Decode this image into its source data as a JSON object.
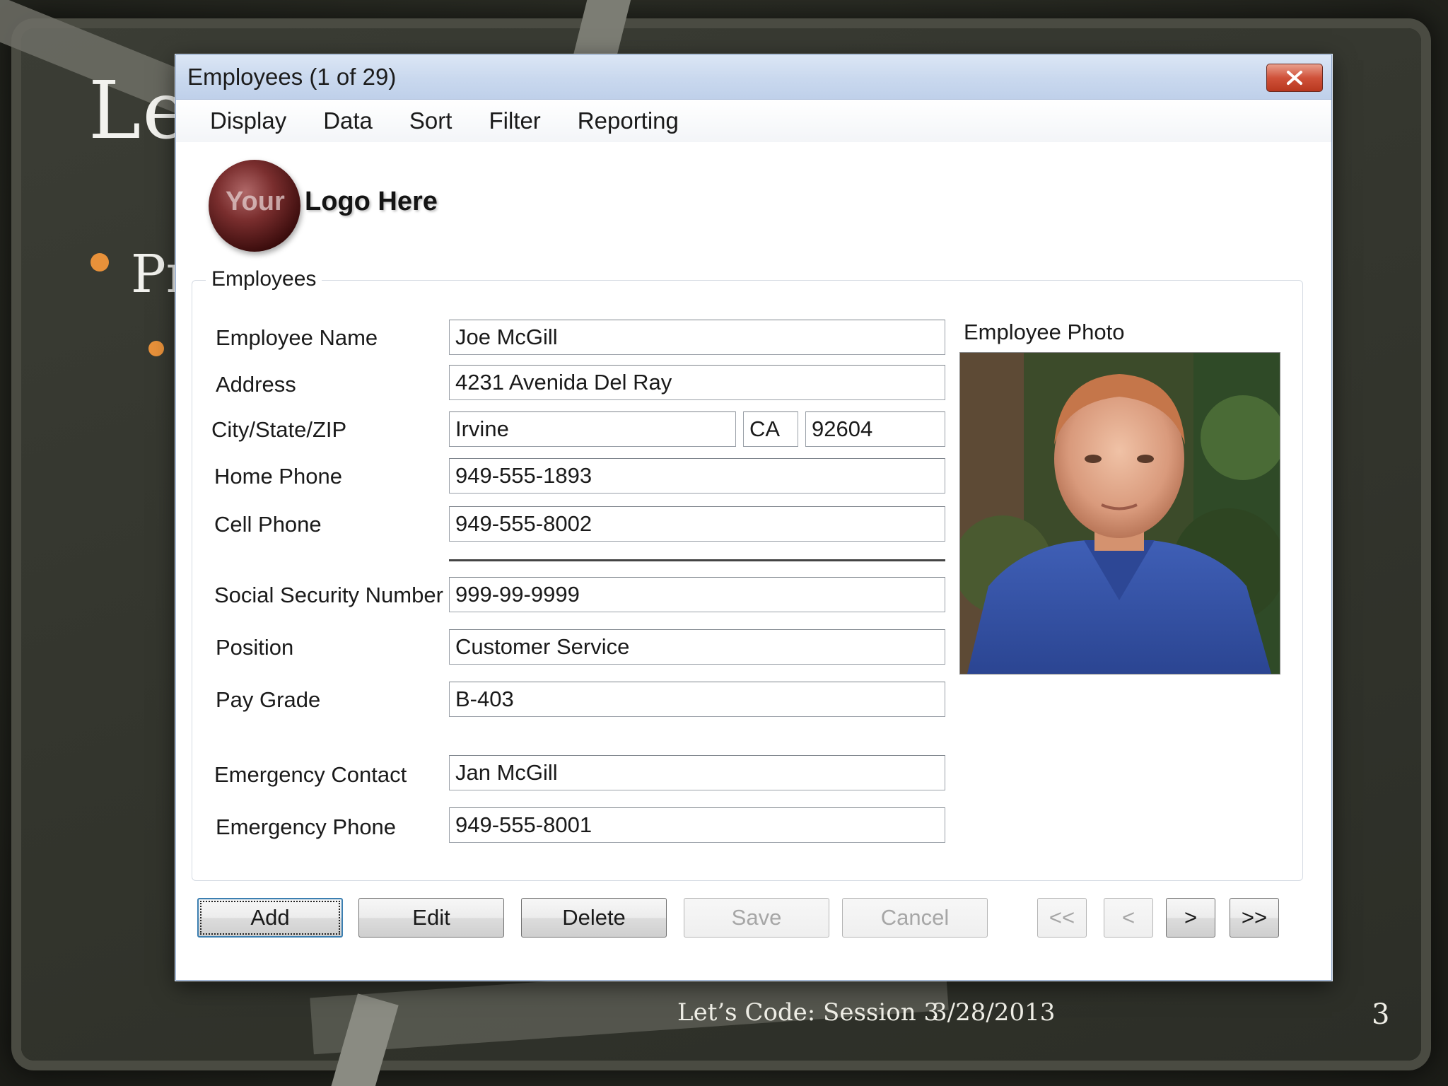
{
  "slide": {
    "title": "Le",
    "bullet_text": "Pr",
    "footer_title": "Let’s Code: Session 3",
    "footer_date": "3/28/2013",
    "page_number": "3"
  },
  "window": {
    "title": "Employees  (1 of 29)",
    "close_icon": "close-x-icon"
  },
  "menu": [
    "Display",
    "Data",
    "Sort",
    "Filter",
    "Reporting"
  ],
  "logo": {
    "your": "Your",
    "here": "Logo Here"
  },
  "group": {
    "label": "Employees"
  },
  "fields": {
    "employee_name": {
      "label": "Employee Name",
      "value": "Joe McGill"
    },
    "address": {
      "label": "Address",
      "value": "4231 Avenida Del Ray"
    },
    "city_state_zip": {
      "label": "City/State/ZIP",
      "city": "Irvine",
      "state": "CA",
      "zip": "92604"
    },
    "home_phone": {
      "label": "Home Phone",
      "value": "949-555-1893"
    },
    "cell_phone": {
      "label": "Cell Phone",
      "value": "949-555-8002"
    },
    "ssn": {
      "label": "Social Security Number",
      "value": "999-99-9999"
    },
    "position": {
      "label": "Position",
      "value": "Customer Service"
    },
    "pay_grade": {
      "label": "Pay Grade",
      "value": "B-403"
    },
    "emergency_contact": {
      "label": "Emergency Contact",
      "value": "Jan McGill"
    },
    "emergency_phone": {
      "label": "Emergency Phone",
      "value": "949-555-8001"
    }
  },
  "photo": {
    "label": "Employee Photo"
  },
  "buttons": {
    "add": "Add",
    "edit": "Edit",
    "delete": "Delete",
    "save": "Save",
    "cancel": "Cancel",
    "first": "<<",
    "prev": "<",
    "next": ">",
    "last": ">>"
  }
}
